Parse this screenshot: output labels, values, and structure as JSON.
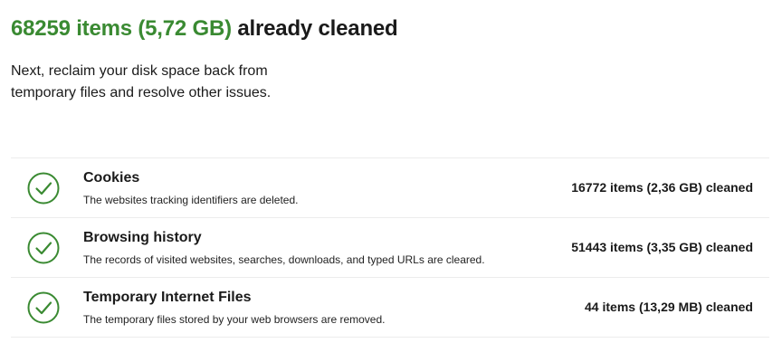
{
  "summary": {
    "count_text": "68259 items (5,72 GB)",
    "suffix_text": "already cleaned",
    "description": "Next, reclaim your disk space back from temporary files and resolve other issues."
  },
  "items": [
    {
      "title": "Cookies",
      "description": "The websites tracking identifiers are deleted.",
      "status": "16772 items (2,36 GB) cleaned",
      "icon": "check-circle-icon"
    },
    {
      "title": "Browsing history",
      "description": "The records of visited websites, searches, downloads, and typed URLs are cleared.",
      "status": "51443 items (3,35 GB) cleaned",
      "icon": "check-circle-icon"
    },
    {
      "title": "Temporary Internet Files",
      "description": "The temporary files stored by your web browsers are removed.",
      "status": "44 items (13,29 MB) cleaned",
      "icon": "check-circle-icon"
    }
  ],
  "colors": {
    "accent": "#3a8a32",
    "text": "#1a1a1a",
    "divider": "#ececec"
  }
}
